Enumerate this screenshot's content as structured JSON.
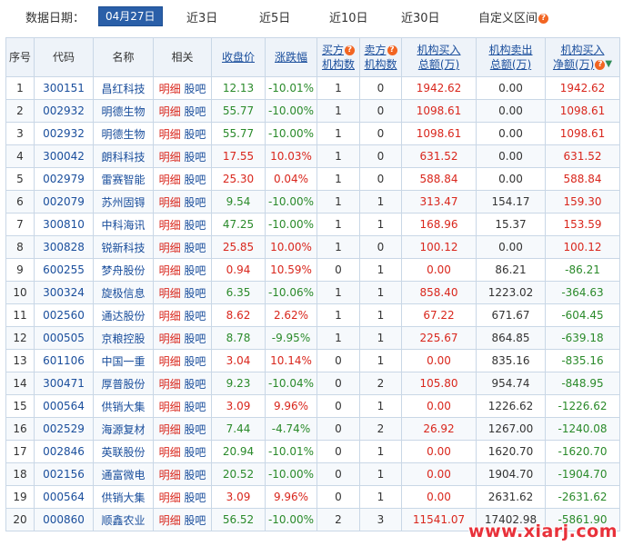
{
  "filter": {
    "label": "数据日期：",
    "options": [
      "04月27日",
      "近3日",
      "近5日",
      "近10日",
      "近30日",
      "自定义区间"
    ],
    "active_index": 0
  },
  "table": {
    "headers": {
      "seq": "序号",
      "code": "代码",
      "name": "名称",
      "related": "相关",
      "close": "收盘价",
      "change": "涨跌幅",
      "buy_count_1": "买方",
      "buy_count_2": "机构数",
      "sell_count_1": "卖方",
      "sell_count_2": "机构数",
      "buy_total_1": "机构买入",
      "buy_total_2": "总额(万)",
      "sell_total_1": "机构卖出",
      "sell_total_2": "总额(万)",
      "net_1": "机构买入",
      "net_2": "净额(万)"
    },
    "related_links": {
      "detail": "明细",
      "forum": "股吧"
    },
    "colors": {
      "red": "#d9261c",
      "green": "#2a8a2a",
      "header_bg": "#eef3f9",
      "active_tab": "#2a5fa8"
    },
    "rows": [
      {
        "seq": "1",
        "code": "300151",
        "name": "昌红科技",
        "close": "12.13",
        "change": "-10.01%",
        "buy_n": "1",
        "sell_n": "0",
        "buy_amt": "1942.62",
        "sell_amt": "0.00",
        "net": "1942.62",
        "dir": "down",
        "net_dir": "up"
      },
      {
        "seq": "2",
        "code": "002932",
        "name": "明德生物",
        "close": "55.77",
        "change": "-10.00%",
        "buy_n": "1",
        "sell_n": "0",
        "buy_amt": "1098.61",
        "sell_amt": "0.00",
        "net": "1098.61",
        "dir": "down",
        "net_dir": "up"
      },
      {
        "seq": "3",
        "code": "002932",
        "name": "明德生物",
        "close": "55.77",
        "change": "-10.00%",
        "buy_n": "1",
        "sell_n": "0",
        "buy_amt": "1098.61",
        "sell_amt": "0.00",
        "net": "1098.61",
        "dir": "down",
        "net_dir": "up"
      },
      {
        "seq": "4",
        "code": "300042",
        "name": "朗科科技",
        "close": "17.55",
        "change": "10.03%",
        "buy_n": "1",
        "sell_n": "0",
        "buy_amt": "631.52",
        "sell_amt": "0.00",
        "net": "631.52",
        "dir": "up",
        "net_dir": "up"
      },
      {
        "seq": "5",
        "code": "002979",
        "name": "雷赛智能",
        "close": "25.30",
        "change": "0.04%",
        "buy_n": "1",
        "sell_n": "0",
        "buy_amt": "588.84",
        "sell_amt": "0.00",
        "net": "588.84",
        "dir": "up",
        "net_dir": "up"
      },
      {
        "seq": "6",
        "code": "002079",
        "name": "苏州固锝",
        "close": "9.54",
        "change": "-10.00%",
        "buy_n": "1",
        "sell_n": "1",
        "buy_amt": "313.47",
        "sell_amt": "154.17",
        "net": "159.30",
        "dir": "down",
        "net_dir": "up"
      },
      {
        "seq": "7",
        "code": "300810",
        "name": "中科海讯",
        "close": "47.25",
        "change": "-10.00%",
        "buy_n": "1",
        "sell_n": "1",
        "buy_amt": "168.96",
        "sell_amt": "15.37",
        "net": "153.59",
        "dir": "down",
        "net_dir": "up"
      },
      {
        "seq": "8",
        "code": "300828",
        "name": "锐新科技",
        "close": "25.85",
        "change": "10.00%",
        "buy_n": "1",
        "sell_n": "0",
        "buy_amt": "100.12",
        "sell_amt": "0.00",
        "net": "100.12",
        "dir": "up",
        "net_dir": "up"
      },
      {
        "seq": "9",
        "code": "600255",
        "name": "梦舟股份",
        "close": "0.94",
        "change": "10.59%",
        "buy_n": "0",
        "sell_n": "1",
        "buy_amt": "0.00",
        "sell_amt": "86.21",
        "net": "-86.21",
        "dir": "up",
        "net_dir": "down"
      },
      {
        "seq": "10",
        "code": "300324",
        "name": "旋极信息",
        "close": "6.35",
        "change": "-10.06%",
        "buy_n": "1",
        "sell_n": "1",
        "buy_amt": "858.40",
        "sell_amt": "1223.02",
        "net": "-364.63",
        "dir": "down",
        "net_dir": "down"
      },
      {
        "seq": "11",
        "code": "002560",
        "name": "通达股份",
        "close": "8.62",
        "change": "2.62%",
        "buy_n": "1",
        "sell_n": "1",
        "buy_amt": "67.22",
        "sell_amt": "671.67",
        "net": "-604.45",
        "dir": "up",
        "net_dir": "down"
      },
      {
        "seq": "12",
        "code": "000505",
        "name": "京粮控股",
        "close": "8.78",
        "change": "-9.95%",
        "buy_n": "1",
        "sell_n": "1",
        "buy_amt": "225.67",
        "sell_amt": "864.85",
        "net": "-639.18",
        "dir": "down",
        "net_dir": "down"
      },
      {
        "seq": "13",
        "code": "601106",
        "name": "中国一重",
        "close": "3.04",
        "change": "10.14%",
        "buy_n": "0",
        "sell_n": "1",
        "buy_amt": "0.00",
        "sell_amt": "835.16",
        "net": "-835.16",
        "dir": "up",
        "net_dir": "down"
      },
      {
        "seq": "14",
        "code": "300471",
        "name": "厚普股份",
        "close": "9.23",
        "change": "-10.04%",
        "buy_n": "0",
        "sell_n": "2",
        "buy_amt": "105.80",
        "sell_amt": "954.74",
        "net": "-848.95",
        "dir": "down",
        "net_dir": "down"
      },
      {
        "seq": "15",
        "code": "000564",
        "name": "供销大集",
        "close": "3.09",
        "change": "9.96%",
        "buy_n": "0",
        "sell_n": "1",
        "buy_amt": "0.00",
        "sell_amt": "1226.62",
        "net": "-1226.62",
        "dir": "up",
        "net_dir": "down"
      },
      {
        "seq": "16",
        "code": "002529",
        "name": "海源复材",
        "close": "7.44",
        "change": "-4.74%",
        "buy_n": "0",
        "sell_n": "2",
        "buy_amt": "26.92",
        "sell_amt": "1267.00",
        "net": "-1240.08",
        "dir": "down",
        "net_dir": "down"
      },
      {
        "seq": "17",
        "code": "002846",
        "name": "英联股份",
        "close": "20.94",
        "change": "-10.01%",
        "buy_n": "0",
        "sell_n": "1",
        "buy_amt": "0.00",
        "sell_amt": "1620.70",
        "net": "-1620.70",
        "dir": "down",
        "net_dir": "down"
      },
      {
        "seq": "18",
        "code": "002156",
        "name": "通富微电",
        "close": "20.52",
        "change": "-10.00%",
        "buy_n": "0",
        "sell_n": "1",
        "buy_amt": "0.00",
        "sell_amt": "1904.70",
        "net": "-1904.70",
        "dir": "down",
        "net_dir": "down"
      },
      {
        "seq": "19",
        "code": "000564",
        "name": "供销大集",
        "close": "3.09",
        "change": "9.96%",
        "buy_n": "0",
        "sell_n": "1",
        "buy_amt": "0.00",
        "sell_amt": "2631.62",
        "net": "-2631.62",
        "dir": "up",
        "net_dir": "down"
      },
      {
        "seq": "20",
        "code": "000860",
        "name": "顺鑫农业",
        "close": "56.52",
        "change": "-10.00%",
        "buy_n": "2",
        "sell_n": "3",
        "buy_amt": "11541.07",
        "sell_amt": "17402.98",
        "net": "-5861.90",
        "dir": "down",
        "net_dir": "down"
      }
    ]
  },
  "watermark": "www.xiarj.com"
}
